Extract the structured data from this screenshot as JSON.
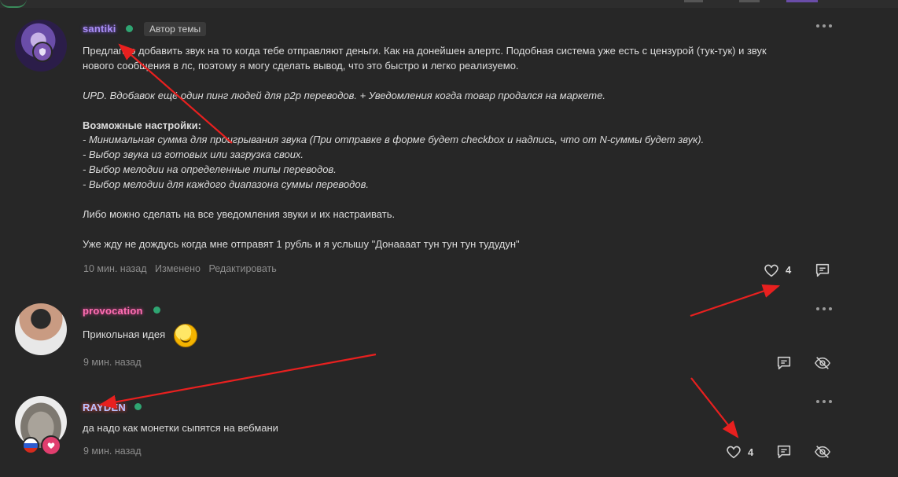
{
  "posts": [
    {
      "username": "santiki",
      "author_tag": "Автор темы",
      "body": {
        "p1_line1": "Предлагаю добавить звук на то когда тебе отправляют деньги. Как на донейшен алертс. Подобная система уже есть с цензурой (тук-тук) и звук",
        "p1_line2": "нового сообщения в лс, поэтому я могу сделать вывод, что это быстро и легко реализуемо.",
        "upd": "UPD. Вдобавок ещё один пинг людей для p2p переводов. + Уведомления когда товар продался на маркете.",
        "settings_title": "Возможные настройки:",
        "settings": [
          "- Минимальная сумма для проигрывания звука (При отправке в форме будет checkbox и надпись, что от N-суммы будет звук).",
          "- Выбор звука из готовых или загрузка своих.",
          "- Выбор мелодии на определенные типы переводов.",
          "- Выбор мелодии для каждого диапазона суммы переводов."
        ],
        "p3": "Либо можно сделать на все уведомления звуки и их настраивать.",
        "p4": "Уже жду не дождусь когда мне отправят 1 рубль и я услышу \"Донаааат тун тун тун тудудун\""
      },
      "meta": {
        "time": "10 мин. назад",
        "edited": "Изменено",
        "edit": "Редактировать"
      },
      "likes": "4"
    },
    {
      "username": "provocation",
      "body": "Прикольная идея",
      "meta": {
        "time": "9 мин. назад"
      }
    },
    {
      "username": "RAYDEN",
      "body": "да надо как монетки сыпятся на вебмани",
      "meta": {
        "time": "9 мин. назад"
      },
      "likes": "4"
    }
  ],
  "icons": {
    "like": "heart-icon",
    "reply": "comment-icon",
    "hide": "eye-off-icon",
    "menu": "more-dots-icon"
  },
  "colors": {
    "background": "#272727",
    "online": "#2fa572",
    "annotation": "#e8201f"
  }
}
